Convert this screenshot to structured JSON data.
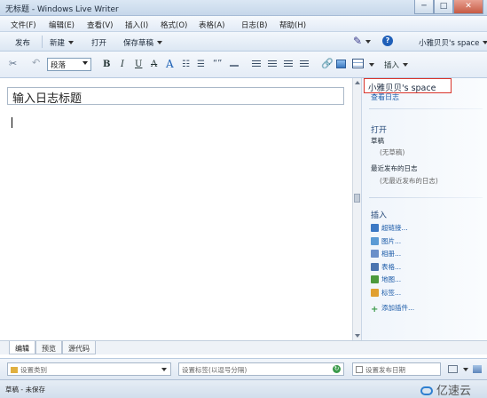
{
  "window": {
    "title": "无标题 - Windows Live Writer",
    "minimize": "─",
    "maximize": "□",
    "close": "✕"
  },
  "menu": [
    "文件(F)",
    "编辑(E)",
    "查看(V)",
    "插入(I)",
    "格式(O)",
    "表格(A)",
    "日志(B)",
    "帮助(H)"
  ],
  "commands": {
    "publish": "发布",
    "new": "新建",
    "open": "打开",
    "save_draft": "保存草稿",
    "blog_account": "小雅贝贝's space"
  },
  "format": {
    "style": "段落",
    "bold": "B",
    "italic": "I",
    "underline": "U",
    "strike": "A",
    "font_color": "A",
    "insert": "插入"
  },
  "editor": {
    "title_placeholder": "输入日志标题"
  },
  "sidebar": {
    "blog_name": "小雅贝贝's space",
    "view_blog": "查看日志",
    "open_heading": "打开",
    "drafts_label": "草稿",
    "drafts_empty": "(无草稿)",
    "recent_label": "最近发布的日志",
    "recent_empty": "(无最近发布的日志)",
    "insert_heading": "插入",
    "insert_items": [
      {
        "label": "超链接...",
        "color": "#3b78c4"
      },
      {
        "label": "图片...",
        "color": "#5b9bd5"
      },
      {
        "label": "相册...",
        "color": "#6a8fc9"
      },
      {
        "label": "表格...",
        "color": "#4a74b0"
      },
      {
        "label": "地图...",
        "color": "#4c9a3c"
      },
      {
        "label": "标签...",
        "color": "#e0a030"
      },
      {
        "label": "添加插件...",
        "color": "#3a9a4a"
      }
    ]
  },
  "tabs": [
    "编辑",
    "预览",
    "源代码"
  ],
  "bottom": {
    "category": "设置类别",
    "tags": "设置标签(以逗号分隔)",
    "date": "设置发布日期"
  },
  "status": {
    "text": "草稿 - 未保存"
  },
  "watermark": "亿速云"
}
